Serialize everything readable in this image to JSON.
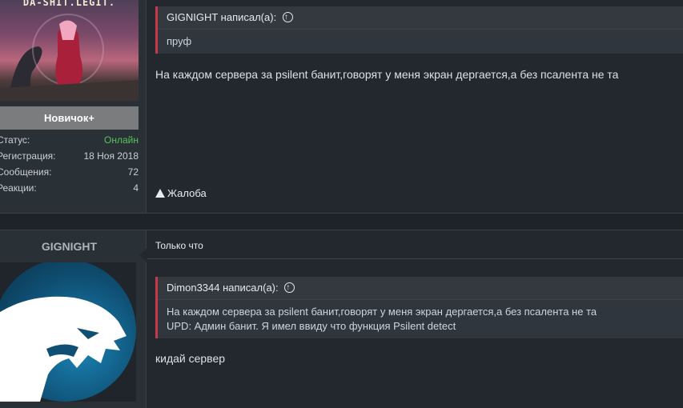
{
  "post1": {
    "author": {
      "avatar_banner": "DA-SHIT.LEGIT.",
      "rank": "Новичок+",
      "stats": [
        {
          "label": "Статус:",
          "value": "Онлайн",
          "online": true
        },
        {
          "label": "Регистрация:",
          "value": "18 Ноя 2018"
        },
        {
          "label": "Сообщения:",
          "value": "72"
        },
        {
          "label": "Реакции:",
          "value": "4"
        }
      ]
    },
    "quote": {
      "header": "GIGNIGHT написал(а):",
      "lines": [
        "пруф"
      ]
    },
    "message": "На каждом сервера за psilent банит,говорят у меня экран дергается,а без псалента не та",
    "report_label": "Жалоба"
  },
  "post2": {
    "author": {
      "username": "GIGNIGHT",
      "avatar_icon": "panther-logo-icon"
    },
    "date": "Только что",
    "quote": {
      "header": "Dimon3344 написал(а):",
      "lines": [
        "На каждом сервера за psilent банит,говорят у меня экран дергается,а без псалента не та",
        "UPD: Админ банит. Я имел ввиду что функция Psilent detect"
      ]
    },
    "message": "кидай сервер"
  },
  "colors": {
    "background": "#22282d",
    "quote_accent": "#c9384a",
    "online": "#58c25d",
    "rank_bg": "#7a7c7e"
  }
}
